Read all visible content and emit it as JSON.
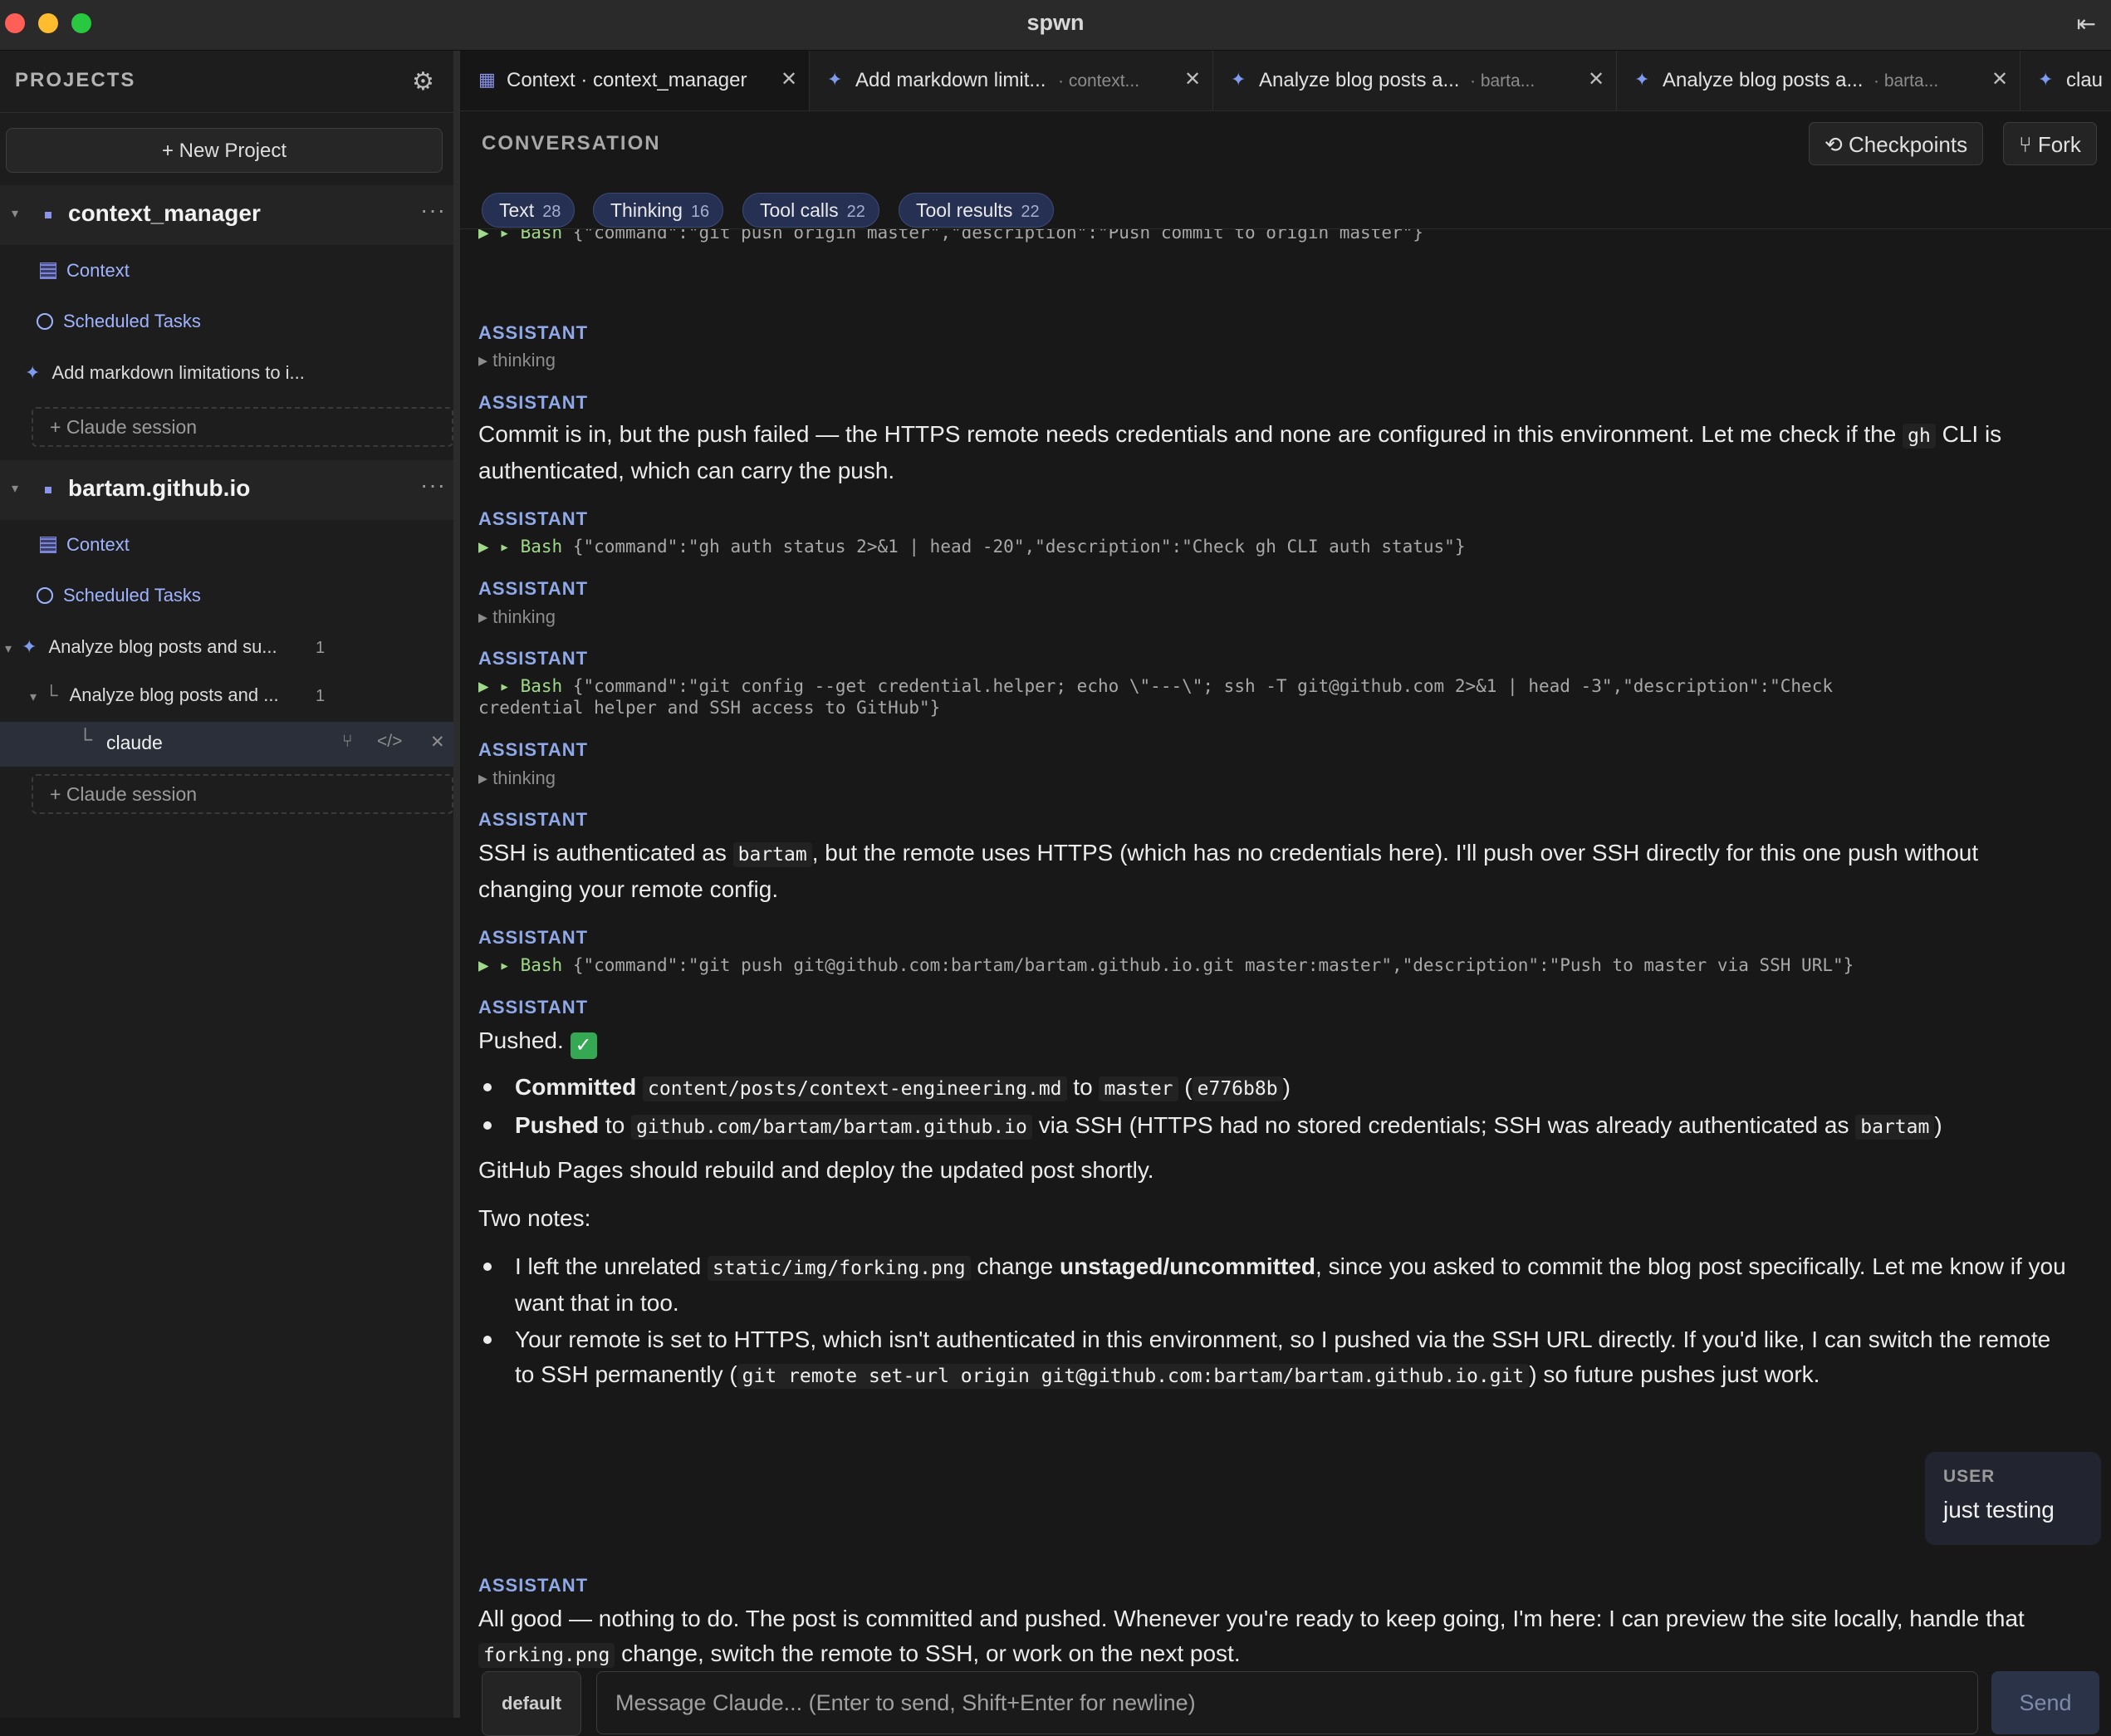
{
  "window": {
    "title": "spwn",
    "collapse_icon": "collapse-left-icon"
  },
  "sidebar": {
    "title": "PROJECTS",
    "new_project": "+ New Project",
    "projects": [
      {
        "name": "context_manager",
        "context_label": "Context",
        "scheduled_label": "Scheduled Tasks",
        "sessions": [
          {
            "title": "Add markdown limitations to i..."
          }
        ],
        "claude_session_label": "+ Claude session"
      },
      {
        "name": "bartam.github.io",
        "context_label": "Context",
        "scheduled_label": "Scheduled Tasks",
        "sessions": [
          {
            "title": "Analyze blog posts and su...",
            "count": "1"
          },
          {
            "title": "Analyze blog posts and ...",
            "count": "1"
          },
          {
            "title": "claude"
          }
        ],
        "claude_session_label": "+ Claude session"
      }
    ]
  },
  "tabs": [
    {
      "label": "Context · context_manager",
      "sub": ""
    },
    {
      "label": "Add markdown limit...",
      "sub": "· context..."
    },
    {
      "label": "Analyze blog posts a...",
      "sub": "· barta..."
    },
    {
      "label": "Analyze blog posts a...",
      "sub": "· barta..."
    },
    {
      "label": "clau",
      "sub": ""
    }
  ],
  "conversation": {
    "title": "CONVERSATION",
    "checkpoints_label": "⟲ Checkpoints",
    "fork_label": "⑂ Fork",
    "filters": [
      {
        "label": "Text",
        "count": "28"
      },
      {
        "label": "Thinking",
        "count": "16"
      },
      {
        "label": "Tool calls",
        "count": "22"
      },
      {
        "label": "Tool results",
        "count": "22"
      }
    ],
    "assistant_label": "ASSISTANT",
    "user_label": "USER",
    "thinking_label": "thinking",
    "tool_prefix": "▶ ▸ ",
    "tool_name": "Bash",
    "tool_cut": "{\"command\":\"git push origin master\",\"description\":\"Push commit to origin master\"}",
    "msg1": {
      "a": "Commit is in, but the push failed — the HTTPS remote needs credentials and none are configured in this environment. Let me check if the ",
      "code": "gh",
      "b": " CLI is authenticated, which can carry the push."
    },
    "tool2": "{\"command\":\"gh auth status 2>&1 | head -20\",\"description\":\"Check gh CLI auth status\"}",
    "tool3_line1": "{\"command\":\"git config --get credential.helper; echo \\\"---\\\"; ssh -T git@github.com 2>&1 | head -3\",\"description\":\"Check",
    "tool3_line2": "credential helper and SSH access to GitHub\"}",
    "msg2": {
      "a": "SSH is authenticated as ",
      "code": "bartam",
      "b": ", but the remote uses HTTPS (which has no credentials here). I'll push over SSH directly for this one push without changing your remote config."
    },
    "tool4": "{\"command\":\"git push git@github.com:bartam/bartam.github.io.git master:master\",\"description\":\"Push to master via SSH URL\"}",
    "msg3": {
      "pushed": "Pushed.",
      "check": "✓",
      "b1": {
        "bold": "Committed",
        "code1": "content/posts/context-engineering.md",
        "to": " to ",
        "code2": "master",
        "p_open": " (",
        "code3": "e776b8b",
        "p_close": ")"
      },
      "b2": {
        "bold": "Pushed",
        "to": " to ",
        "code1": "github.com/bartam/bartam.github.io",
        "mid": " via SSH (HTTPS had no stored credentials; SSH was already authenticated as ",
        "code2": "bartam",
        "end": ")"
      },
      "rebuild": "GitHub Pages should rebuild and deploy the updated post shortly.",
      "two_notes": "Two notes:",
      "n1": {
        "a": "I left the unrelated ",
        "code": "static/img/forking.png",
        "b": " change ",
        "bold": "unstaged/uncommitted",
        "c": ", since you asked to commit the blog post specifically. Let me know if you want that in too."
      },
      "n2": {
        "a": "Your remote is set to HTTPS, which isn't authenticated in this environment, so I pushed via the SSH URL directly. If you'd like, I can switch the remote to SSH permanently (",
        "code": "git remote set-url origin git@github.com:bartam/bartam.github.io.git",
        "b": ") so future pushes just work."
      }
    },
    "user_msg": "just testing",
    "msg4": {
      "a": "All good — nothing to do. The post is committed and pushed. Whenever you're ready to keep going, I'm here: I can preview the site locally, handle that ",
      "code": "forking.png",
      "b": " change, switch the remote to SSH, or work on the next post."
    }
  },
  "composer": {
    "model": "default",
    "placeholder": "Message Claude...  (Enter to send, Shift+Enter for newline)",
    "send": "Send"
  }
}
